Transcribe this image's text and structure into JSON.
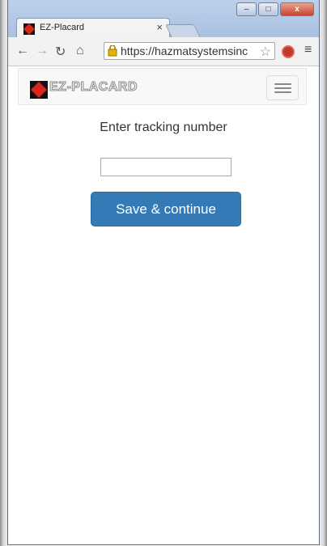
{
  "browser": {
    "tab_title": "EZ-Placard",
    "tab_close": "×",
    "url": "https://hazmatsystemsinc",
    "window_controls": {
      "minimize": "–",
      "maximize": "□",
      "close": "x"
    }
  },
  "navbar": {
    "brand": "EZ-PLACARD"
  },
  "form": {
    "label": "Enter tracking number",
    "input_value": "",
    "input_placeholder": "",
    "submit_label": "Save & continue"
  },
  "colors": {
    "primary_button": "#337ab7",
    "brand_red": "#d9261c"
  }
}
